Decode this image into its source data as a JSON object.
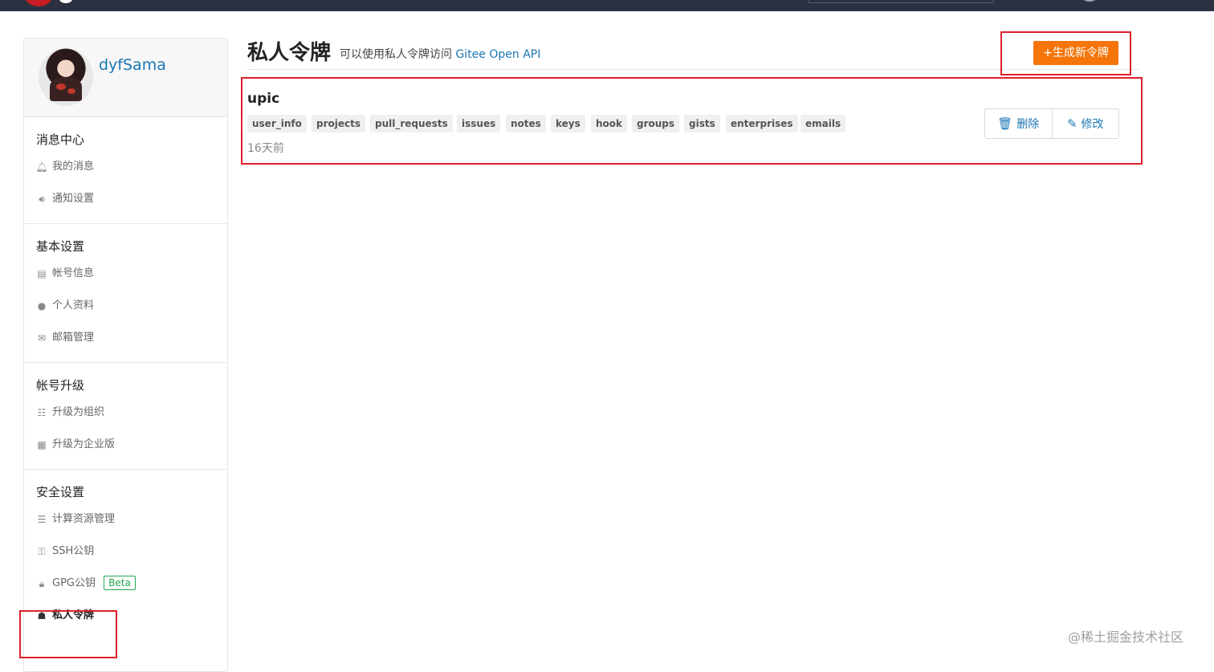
{
  "user": {
    "username": "dyfSama"
  },
  "sidebar": {
    "sections": [
      {
        "title": "消息中心",
        "items": [
          {
            "label": "我的消息",
            "icon": "bell-icon"
          },
          {
            "label": "通知设置",
            "icon": "speaker-icon"
          }
        ]
      },
      {
        "title": "基本设置",
        "items": [
          {
            "label": "帐号信息",
            "icon": "id-card-icon"
          },
          {
            "label": "个人资料",
            "icon": "user-icon"
          },
          {
            "label": "邮箱管理",
            "icon": "envelope-icon"
          }
        ]
      },
      {
        "title": "帐号升级",
        "items": [
          {
            "label": "升级为组织",
            "icon": "users-icon"
          },
          {
            "label": "升级为企业版",
            "icon": "building-icon"
          }
        ]
      },
      {
        "title": "安全设置",
        "items": [
          {
            "label": "计算资源管理",
            "icon": "server-icon"
          },
          {
            "label": "SSH公钥",
            "icon": "key-icon"
          },
          {
            "label": "GPG公钥",
            "icon": "lock-icon",
            "badge": "Beta"
          },
          {
            "label": "私人令牌",
            "icon": "token-icon",
            "active": true
          }
        ]
      }
    ]
  },
  "header": {
    "title": "私人令牌",
    "description": "可以使用私人令牌访问",
    "api_link": "Gitee Open API",
    "new_token_button": "+生成新令牌"
  },
  "token": {
    "name": "upic",
    "scopes": [
      "user_info",
      "projects",
      "pull_requests",
      "issues",
      "notes",
      "keys",
      "hook",
      "groups",
      "gists",
      "enterprises",
      "emails"
    ],
    "time": "16天前",
    "delete_label": "删除",
    "edit_label": "修改"
  },
  "watermark": "@稀土掘金技术社区",
  "colors": {
    "accent": "#1b76b3",
    "primary_button": "#f5750a",
    "highlight": "#e0202a",
    "beta": "#21a94f"
  }
}
